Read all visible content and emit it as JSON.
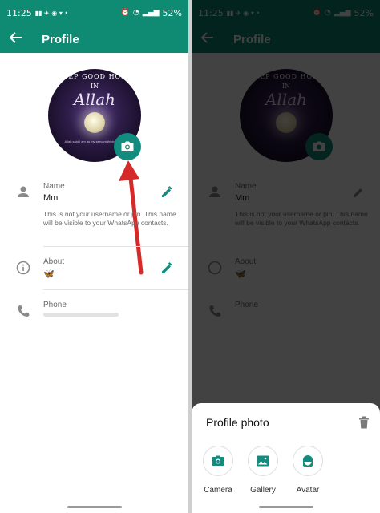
{
  "status": {
    "time": "11:25",
    "battery": "52%"
  },
  "appbar": {
    "title": "Profile"
  },
  "photo": {
    "line1": "EEP GOOD HOP",
    "line2": "IN",
    "script": "Allah",
    "small": "Allah said I am as my servant thinks of me"
  },
  "name": {
    "label": "Name",
    "value": "Mm",
    "hint": "This is not your username or pin. This name will be visible to your WhatsApp contacts."
  },
  "about": {
    "label": "About",
    "value": "🦋"
  },
  "phone": {
    "label": "Phone"
  },
  "sheet": {
    "title": "Profile photo",
    "options": [
      {
        "label": "Camera",
        "icon": "camera-icon"
      },
      {
        "label": "Gallery",
        "icon": "gallery-icon"
      },
      {
        "label": "Avatar",
        "icon": "avatar-icon"
      }
    ]
  },
  "colors": {
    "primary": "#0f8a73",
    "accent": "#128c7e",
    "arrow": "#d62a2a"
  }
}
